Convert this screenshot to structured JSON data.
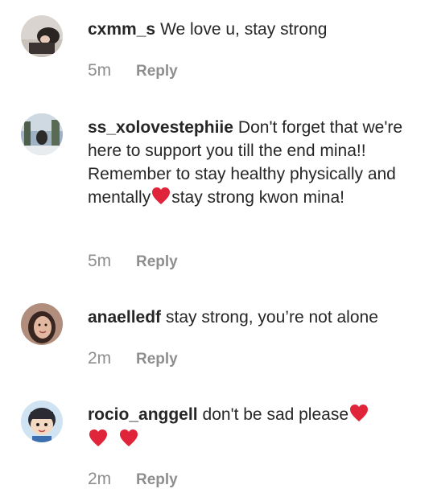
{
  "comments": [
    {
      "username": "cxmm_s",
      "text": "We love u, stay strong",
      "time": "5m",
      "reply_label": "Reply",
      "avatar": "avatar-photo-dark-hair"
    },
    {
      "username": "ss_xolovestephiie",
      "text_parts": [
        "Don't forget that we're here to support you till the end mina!! Remember to stay healthy physically and mentally",
        "stay strong kwon mina!"
      ],
      "time": "5m",
      "reply_label": "Reply",
      "avatar": "avatar-photo-outdoor"
    },
    {
      "username": "anaelledf",
      "text": "stay strong, you’re not alone",
      "time": "2m",
      "reply_label": "Reply",
      "avatar": "avatar-photo-face"
    },
    {
      "username": "rocio_anggell",
      "text": "don't be sad please",
      "time": "2m",
      "reply_label": "Reply",
      "avatar": "avatar-photo-cartoon-boy"
    }
  ],
  "icons": {
    "heart": "two-hearts-emoji",
    "heart_color": "#e0243a"
  }
}
